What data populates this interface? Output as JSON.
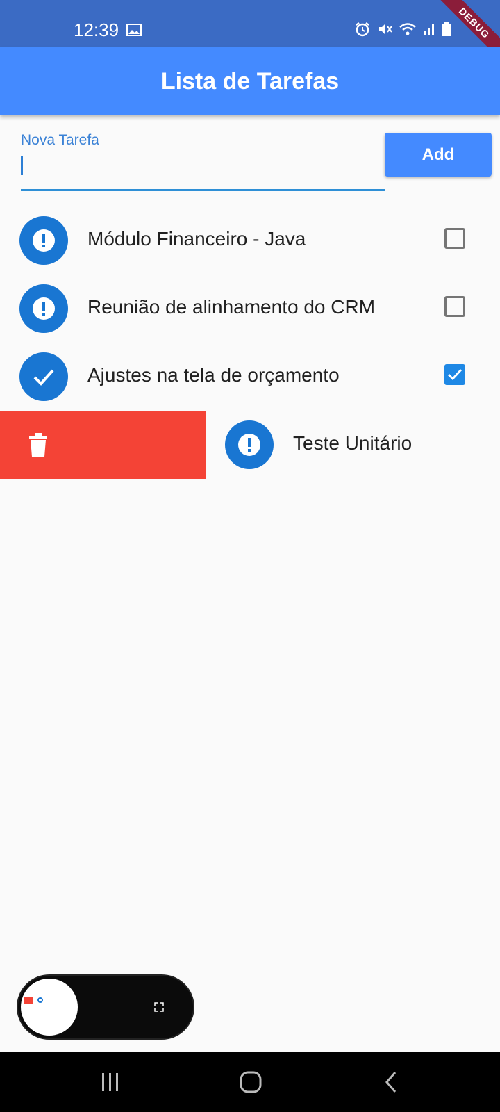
{
  "status_bar": {
    "time": "12:39",
    "icons": [
      "image-icon",
      "alarm-icon",
      "mute-icon",
      "wifi-icon",
      "signal-icon",
      "battery-icon"
    ],
    "debug_label": "DEBUG"
  },
  "app_bar": {
    "title": "Lista de Tarefas"
  },
  "new_task": {
    "label": "Nova Tarefa",
    "value": "",
    "add_label": "Add"
  },
  "tasks": [
    {
      "label": "Módulo Financeiro - Java",
      "done": false,
      "icon": "exclamation-icon"
    },
    {
      "label": "Reunião de alinhamento do CRM",
      "done": false,
      "icon": "exclamation-icon"
    },
    {
      "label": "Ajustes na tela de orçamento",
      "done": true,
      "icon": "check-icon"
    }
  ],
  "swiped_task": {
    "label": "Teste Unitário",
    "icon": "exclamation-icon",
    "action_icon": "trash-icon"
  },
  "colors": {
    "primary": "#448aff",
    "status_bar": "#3b6bc4",
    "avatar": "#1976d2",
    "delete": "#f44336",
    "checkbox_checked": "#1e88e5"
  },
  "nav_bar": {
    "buttons": [
      "recent-apps-icon",
      "home-icon",
      "back-icon"
    ]
  }
}
